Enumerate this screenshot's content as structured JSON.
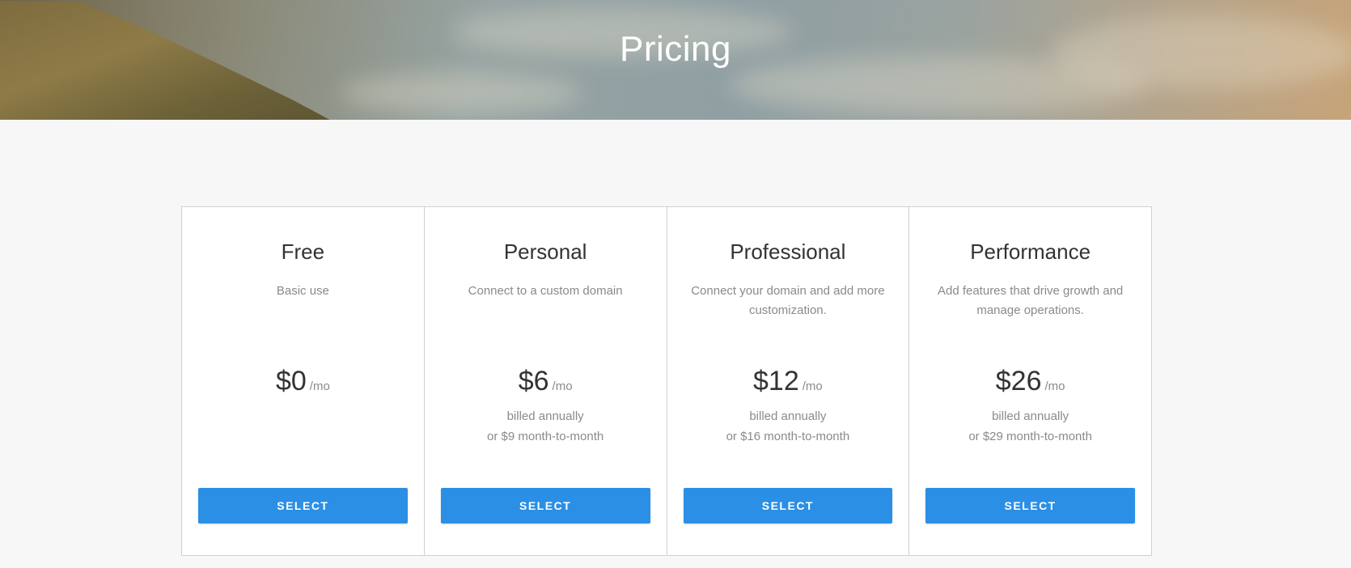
{
  "hero": {
    "title": "Pricing"
  },
  "plans": [
    {
      "name": "Free",
      "description": "Basic use",
      "price": "$0",
      "period": "/mo",
      "billing_line1": "",
      "billing_line2": "",
      "button_label": "SELECT"
    },
    {
      "name": "Personal",
      "description": "Connect to a custom domain",
      "price": "$6",
      "period": "/mo",
      "billing_line1": "billed annually",
      "billing_line2": "or $9 month-to-month",
      "button_label": "SELECT"
    },
    {
      "name": "Professional",
      "description": "Connect your domain and add more customization.",
      "price": "$12",
      "period": "/mo",
      "billing_line1": "billed annually",
      "billing_line2": "or $16 month-to-month",
      "button_label": "SELECT"
    },
    {
      "name": "Performance",
      "description": "Add features that drive growth and manage operations.",
      "price": "$26",
      "period": "/mo",
      "billing_line1": "billed annually",
      "billing_line2": "or $29 month-to-month",
      "button_label": "SELECT"
    }
  ],
  "colors": {
    "button": "#2b8fe6",
    "page_background": "#f7f7f7",
    "card_background": "#ffffff",
    "muted_text": "#8a8a8a"
  }
}
